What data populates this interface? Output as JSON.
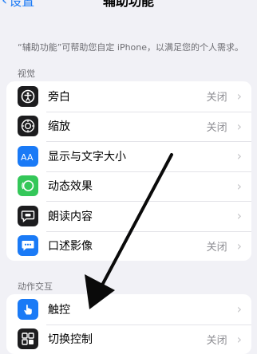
{
  "nav": {
    "back_label": "设置",
    "title": "辅助功能"
  },
  "description": "“辅助功能”可帮助您自定 iPhone，以满足您的个人需求。",
  "sections": {
    "vision": {
      "header": "视觉",
      "items": [
        {
          "label": "旁白",
          "value": "关闭",
          "icon": "voiceover-icon",
          "color": "#1c1c1e"
        },
        {
          "label": "缩放",
          "value": "关闭",
          "icon": "zoom-icon",
          "color": "#1c1c1e"
        },
        {
          "label": "显示与文字大小",
          "value": "",
          "icon": "text-size-icon",
          "color": "#1a7af6"
        },
        {
          "label": "动态效果",
          "value": "",
          "icon": "motion-icon",
          "color": "#34c759"
        },
        {
          "label": "朗读内容",
          "value": "",
          "icon": "spoken-content-icon",
          "color": "#1c1c1e"
        },
        {
          "label": "口述影像",
          "value": "关闭",
          "icon": "audio-description-icon",
          "color": "#1a7af6"
        }
      ]
    },
    "interaction": {
      "header": "动作交互",
      "items": [
        {
          "label": "触控",
          "value": "",
          "icon": "touch-icon",
          "color": "#1a7af6"
        },
        {
          "label": "切换控制",
          "value": "关闭",
          "icon": "switch-control-icon",
          "color": "#1c1c1e"
        }
      ]
    }
  },
  "chevron": "›"
}
